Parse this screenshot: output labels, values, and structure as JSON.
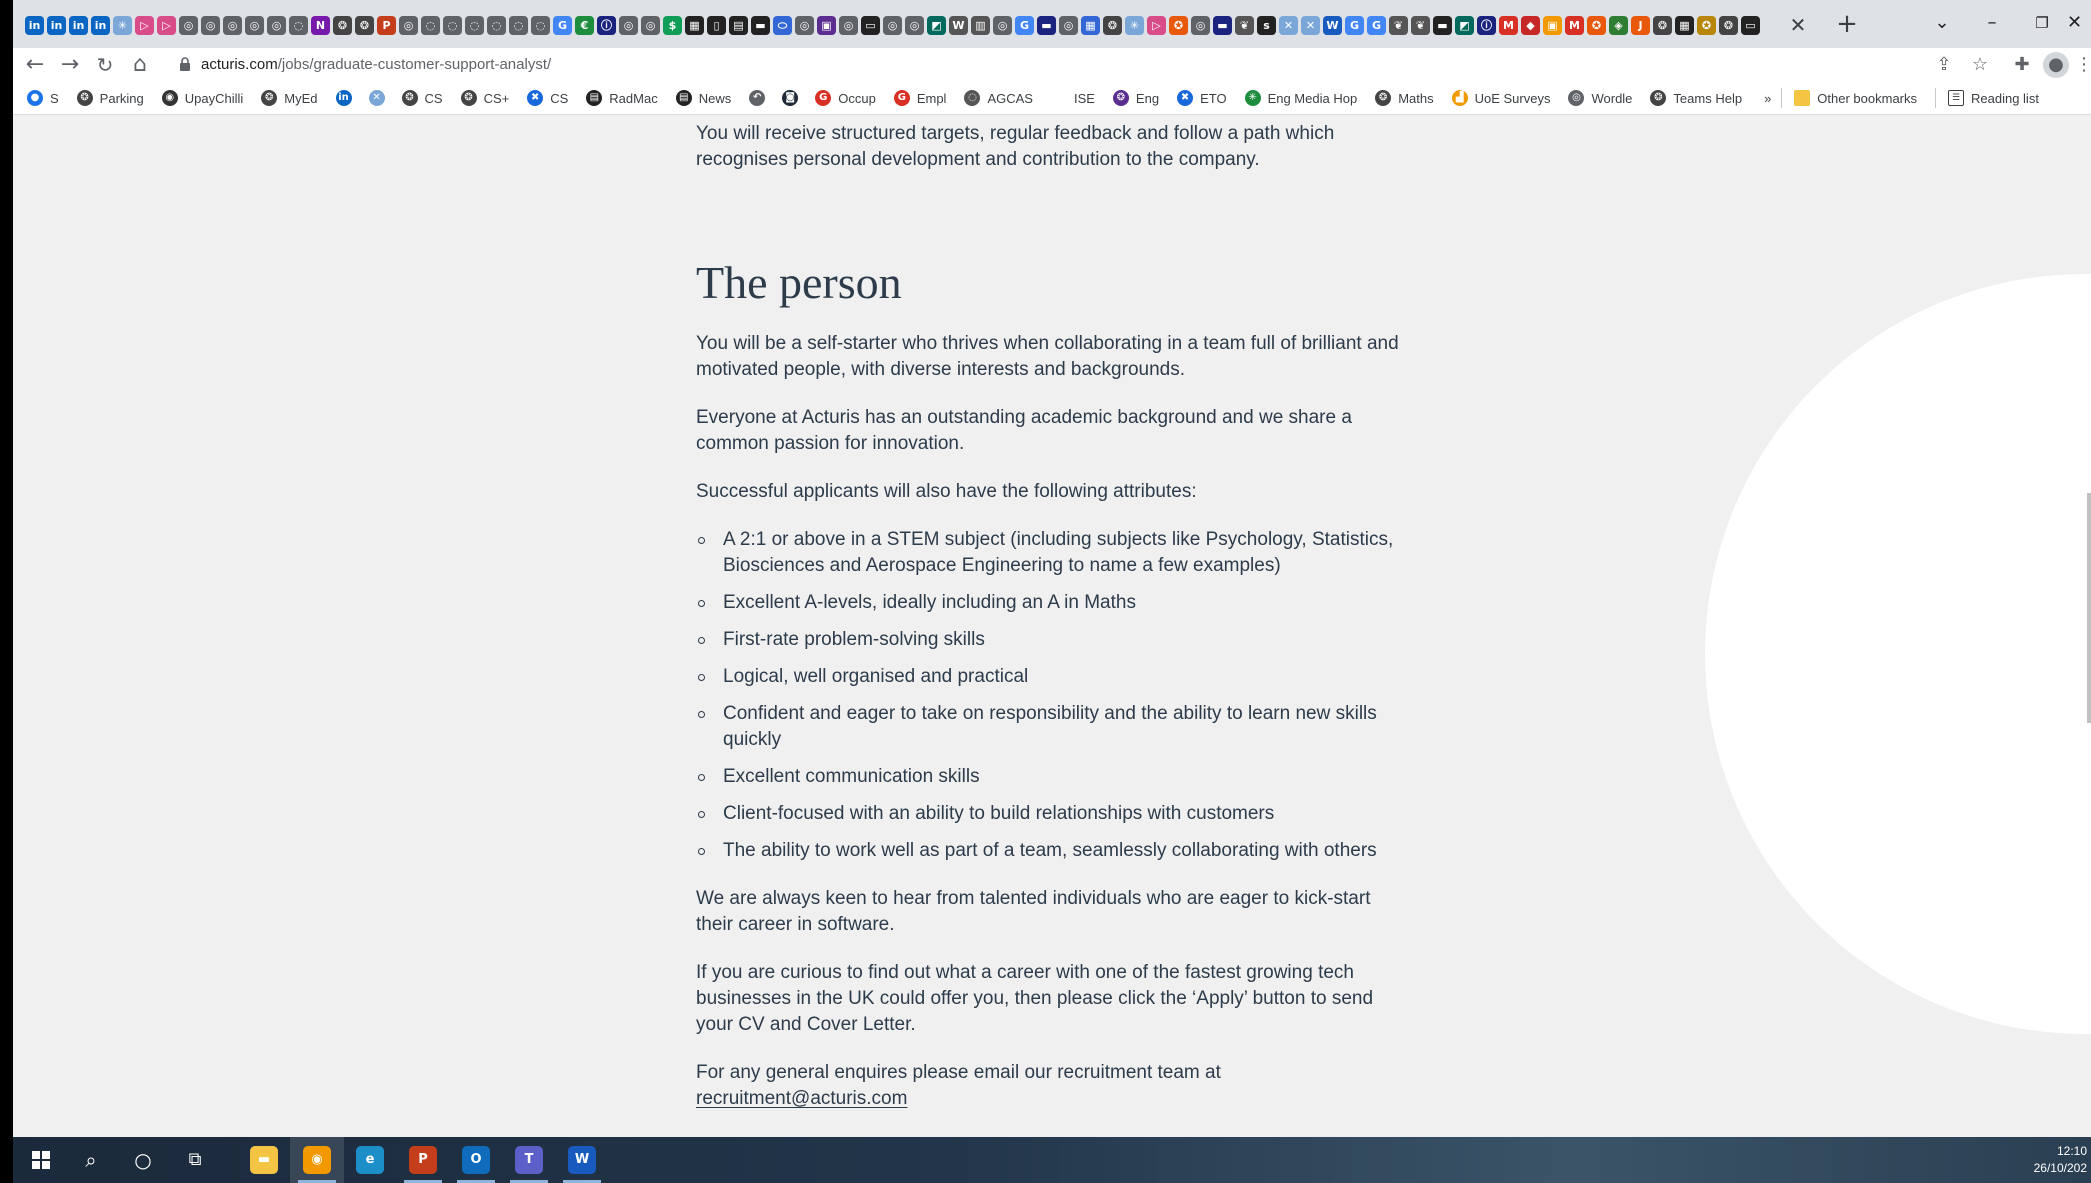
{
  "browser": {
    "tab_favicons": [
      {
        "name": "linkedin-icon",
        "glyph": "in",
        "color": "#0a66c2"
      },
      {
        "name": "linkedin-icon",
        "glyph": "in",
        "color": "#0a66c2"
      },
      {
        "name": "linkedin-icon",
        "glyph": "in",
        "color": "#0a66c2"
      },
      {
        "name": "linkedin-icon",
        "glyph": "in",
        "color": "#0a66c2"
      },
      {
        "name": "sparkle-icon",
        "glyph": "✳",
        "color": "#7aa7d8"
      },
      {
        "name": "play-icon",
        "glyph": "▷",
        "color": "#d94c8a"
      },
      {
        "name": "play-icon",
        "glyph": "▷",
        "color": "#d94c8a"
      },
      {
        "name": "globe-icon",
        "glyph": "◎",
        "color": "#5f6368"
      },
      {
        "name": "globe-icon",
        "glyph": "◎",
        "color": "#5f6368"
      },
      {
        "name": "globe-icon",
        "glyph": "◎",
        "color": "#5f6368"
      },
      {
        "name": "globe-icon",
        "glyph": "◎",
        "color": "#5f6368"
      },
      {
        "name": "globe-icon",
        "glyph": "◎",
        "color": "#5f6368"
      },
      {
        "name": "loading-icon",
        "glyph": "◌",
        "color": "#5f6368"
      },
      {
        "name": "onenote-icon",
        "glyph": "N",
        "color": "#7719aa"
      },
      {
        "name": "cog-icon",
        "glyph": "❂",
        "color": "#444444"
      },
      {
        "name": "cog-icon",
        "glyph": "❂",
        "color": "#444444"
      },
      {
        "name": "powerpoint-icon",
        "glyph": "P",
        "color": "#c43e1c"
      },
      {
        "name": "globe-icon",
        "glyph": "◎",
        "color": "#5f6368"
      },
      {
        "name": "loading-icon",
        "glyph": "◌",
        "color": "#5f6368"
      },
      {
        "name": "loading-icon",
        "glyph": "◌",
        "color": "#5f6368"
      },
      {
        "name": "loading-icon",
        "glyph": "◌",
        "color": "#5f6368"
      },
      {
        "name": "loading-icon",
        "glyph": "◌",
        "color": "#5f6368"
      },
      {
        "name": "loading-icon",
        "glyph": "◌",
        "color": "#5f6368"
      },
      {
        "name": "loading-icon",
        "glyph": "◌",
        "color": "#5f6368"
      },
      {
        "name": "google-icon",
        "glyph": "G",
        "color": "#4285f4"
      },
      {
        "name": "leaf-icon",
        "glyph": "€",
        "color": "#1e8e3e"
      },
      {
        "name": "info-icon",
        "glyph": "ⓘ",
        "color": "#1a237e"
      },
      {
        "name": "globe-icon",
        "glyph": "◎",
        "color": "#5f6368"
      },
      {
        "name": "globe-icon",
        "glyph": "◎",
        "color": "#5f6368"
      },
      {
        "name": "dollar-icon",
        "glyph": "$",
        "color": "#0f9d58"
      },
      {
        "name": "grid-icon",
        "glyph": "▦",
        "color": "#222222"
      },
      {
        "name": "phone-icon",
        "glyph": "▯",
        "color": "#222222"
      },
      {
        "name": "box-icon",
        "glyph": "▤",
        "color": "#222222"
      },
      {
        "name": "bar-icon",
        "glyph": "▬",
        "color": "#222222"
      },
      {
        "name": "oval-icon",
        "glyph": "⬭",
        "color": "#3367d6"
      },
      {
        "name": "globe-icon",
        "glyph": "◎",
        "color": "#5f6368"
      },
      {
        "name": "purple-square-icon",
        "glyph": "▣",
        "color": "#5c2d91"
      },
      {
        "name": "globe-icon",
        "glyph": "◎",
        "color": "#5f6368"
      },
      {
        "name": "dash-icon",
        "glyph": "▭",
        "color": "#222222"
      },
      {
        "name": "globe-icon",
        "glyph": "◎",
        "color": "#5f6368"
      },
      {
        "name": "globe-icon",
        "glyph": "◎",
        "color": "#5f6368"
      },
      {
        "name": "teal-icon",
        "glyph": "◩",
        "color": "#00695c"
      },
      {
        "name": "wikipedia-icon",
        "glyph": "W",
        "color": "#555555"
      },
      {
        "name": "calendar-icon",
        "glyph": "▥",
        "color": "#555555"
      },
      {
        "name": "globe-icon",
        "glyph": "◎",
        "color": "#5f6368"
      },
      {
        "name": "google-icon",
        "glyph": "G",
        "color": "#4285f4"
      },
      {
        "name": "navy-icon",
        "glyph": "▬",
        "color": "#1a237e"
      },
      {
        "name": "globe-icon",
        "glyph": "◎",
        "color": "#5f6368"
      },
      {
        "name": "table-icon",
        "glyph": "▦",
        "color": "#3367d6"
      },
      {
        "name": "cog-icon",
        "glyph": "❂",
        "color": "#444444"
      },
      {
        "name": "sparkle-icon",
        "glyph": "✳",
        "color": "#7aa7d8"
      },
      {
        "name": "play-icon",
        "glyph": "▷",
        "color": "#d94c8a"
      },
      {
        "name": "orange-icon",
        "glyph": "✪",
        "color": "#e8590c"
      },
      {
        "name": "globe-icon",
        "glyph": "◎",
        "color": "#5f6368"
      },
      {
        "name": "navy-icon",
        "glyph": "▬",
        "color": "#1a237e"
      },
      {
        "name": "shell-icon",
        "glyph": "❦",
        "color": "#555555"
      },
      {
        "name": "s-icon",
        "glyph": "s",
        "color": "#222222"
      },
      {
        "name": "network-icon",
        "glyph": "✕",
        "color": "#7aa7d8"
      },
      {
        "name": "network-icon",
        "glyph": "✕",
        "color": "#7aa7d8"
      },
      {
        "name": "word-icon",
        "glyph": "W",
        "color": "#185abd"
      },
      {
        "name": "google-icon",
        "glyph": "G",
        "color": "#4285f4"
      },
      {
        "name": "google-icon",
        "glyph": "G",
        "color": "#4285f4"
      },
      {
        "name": "shell-icon",
        "glyph": "❦",
        "color": "#555555"
      },
      {
        "name": "shell-icon",
        "glyph": "❦",
        "color": "#555555"
      },
      {
        "name": "bar-icon",
        "glyph": "▬",
        "color": "#222222"
      },
      {
        "name": "teal-icon",
        "glyph": "◩",
        "color": "#00695c"
      },
      {
        "name": "info-icon",
        "glyph": "ⓘ",
        "color": "#1a237e"
      },
      {
        "name": "gmail-icon",
        "glyph": "M",
        "color": "#d93025"
      },
      {
        "name": "red-cube-icon",
        "glyph": "◆",
        "color": "#c62828"
      },
      {
        "name": "orange-square-icon",
        "glyph": "▣",
        "color": "#f29900"
      },
      {
        "name": "gmail-icon",
        "glyph": "M",
        "color": "#d93025"
      },
      {
        "name": "orange-icon",
        "glyph": "✪",
        "color": "#e8590c"
      },
      {
        "name": "green-icon",
        "glyph": "◈",
        "color": "#2e7d32"
      },
      {
        "name": "orange-j-icon",
        "glyph": "J",
        "color": "#e8590c"
      },
      {
        "name": "cog-icon",
        "glyph": "❂",
        "color": "#444444"
      },
      {
        "name": "grid-icon",
        "glyph": "▦",
        "color": "#222222"
      },
      {
        "name": "star-badge-icon",
        "glyph": "✪",
        "color": "#b8860b"
      },
      {
        "name": "cog-icon",
        "glyph": "❂",
        "color": "#444444"
      },
      {
        "name": "keyboard-icon",
        "glyph": "▭",
        "color": "#222222"
      }
    ],
    "url_host": "acturis.com",
    "url_path": "/jobs/graduate-customer-support-analyst/",
    "bookmarks": [
      {
        "label": "S",
        "icon": "circle-icon",
        "glyph": "●",
        "color": "#1a73e8"
      },
      {
        "label": "Parking",
        "icon": "cog-icon",
        "glyph": "❂",
        "color": "#444444"
      },
      {
        "label": "UpayChilli",
        "icon": "shield-icon",
        "glyph": "◉",
        "color": "#333333"
      },
      {
        "label": "MyEd",
        "icon": "cog-icon",
        "glyph": "❂",
        "color": "#444444"
      },
      {
        "label": "",
        "icon": "linkedin-icon",
        "glyph": "in",
        "color": "#0a66c2"
      },
      {
        "label": "",
        "icon": "network-icon",
        "glyph": "✕",
        "color": "#7aa7d8"
      },
      {
        "label": "CS",
        "icon": "cog-icon",
        "glyph": "❂",
        "color": "#444444"
      },
      {
        "label": "CS+",
        "icon": "cog-icon",
        "glyph": "❂",
        "color": "#444444"
      },
      {
        "label": "CS",
        "icon": "confluence-icon",
        "glyph": "✖",
        "color": "#1868db"
      },
      {
        "label": "RadMac",
        "icon": "box-icon",
        "glyph": "▤",
        "color": "#222222"
      },
      {
        "label": "News",
        "icon": "box-icon",
        "glyph": "▤",
        "color": "#222222"
      },
      {
        "label": "",
        "icon": "swirl-icon",
        "glyph": "↶",
        "color": "#5f6368"
      },
      {
        "label": "",
        "icon": "dark-square-icon",
        "glyph": "◙",
        "color": "#1f2937"
      },
      {
        "label": "Occup",
        "icon": "red-loop-icon",
        "glyph": "G",
        "color": "#d93025"
      },
      {
        "label": "Empl",
        "icon": "red-loop-icon",
        "glyph": "G",
        "color": "#d93025"
      },
      {
        "label": "AGCAS",
        "icon": "ring-icon",
        "glyph": "◌",
        "color": "#555555"
      },
      {
        "label": "ISE",
        "icon": "blank-icon",
        "glyph": "",
        "color": "#ffffff"
      },
      {
        "label": "Eng",
        "icon": "cog-icon",
        "glyph": "❂",
        "color": "#5c2d91"
      },
      {
        "label": "ETO",
        "icon": "confluence-icon",
        "glyph": "✖",
        "color": "#1868db"
      },
      {
        "label": "Eng Media Hop",
        "icon": "sparkle-icon",
        "glyph": "✳",
        "color": "#1e8e3e"
      },
      {
        "label": "Maths",
        "icon": "cog-icon",
        "glyph": "❂",
        "color": "#444444"
      },
      {
        "label": "UoE Surveys",
        "icon": "chart-icon",
        "glyph": "▟",
        "color": "#f29900"
      },
      {
        "label": "Wordle",
        "icon": "globe-icon",
        "glyph": "◎",
        "color": "#5f6368"
      },
      {
        "label": "Teams Help",
        "icon": "cog-icon",
        "glyph": "❂",
        "color": "#444444"
      }
    ],
    "bookmarks_overflow": "»",
    "other_bookmarks": "Other bookmarks",
    "reading_list": "Reading list"
  },
  "page": {
    "intro_paragraph": "You will receive structured targets, regular feedback and follow a path which recognises personal development and contribution to the company.",
    "section_heading": "The person",
    "paragraphs_before": [
      "You will be a self-starter who thrives when collaborating in a team full of brilliant and motivated people, with diverse interests and backgrounds.",
      "Everyone at Acturis has an outstanding academic background and we share a common passion for innovation.",
      "Successful applicants will also have the following attributes:"
    ],
    "attributes": [
      "A 2:1 or above in a STEM subject (including subjects like Psychology, Statistics, Biosciences and Aerospace Engineering to name a few examples)",
      "Excellent A-levels, ideally including an A in Maths",
      "First-rate problem-solving skills",
      "Logical, well organised and practical",
      "Confident and eager to take on responsibility and the ability to learn new skills quickly",
      "Excellent communication skills",
      "Client-focused with an ability to build relationships with customers",
      "The ability to work well as part of a team, seamlessly collaborating with others"
    ],
    "paragraphs_after": [
      "We are always keen to hear from talented individuals who are eager to kick-start their career in software.",
      "If you are curious to find out what a career with one of the fastest growing tech businesses in the UK could offer you, then please click the ‘Apply’ button to send your CV and Cover Letter."
    ],
    "contact_text": "For any general enquires please email our recruitment team at",
    "contact_email": "recruitment@acturis.com"
  },
  "taskbar": {
    "time": "12:10",
    "date": "26/10/202",
    "apps": [
      {
        "name": "file-explorer-icon",
        "glyph": "▬",
        "color": "#f4c542",
        "active": false
      },
      {
        "name": "chrome-icon",
        "glyph": "◉",
        "color": "#f29900",
        "active": true
      },
      {
        "name": "edge-icon",
        "glyph": "e",
        "color": "#1c8fc9",
        "active": false
      },
      {
        "name": "powerpoint-icon",
        "glyph": "P",
        "color": "#c43e1c",
        "active": true
      },
      {
        "name": "outlook-icon",
        "glyph": "O",
        "color": "#0f6cbd",
        "active": true
      },
      {
        "name": "teams-icon",
        "glyph": "T",
        "color": "#5b5fc7",
        "active": true
      },
      {
        "name": "word-icon",
        "glyph": "W",
        "color": "#185abd",
        "active": true
      }
    ]
  }
}
